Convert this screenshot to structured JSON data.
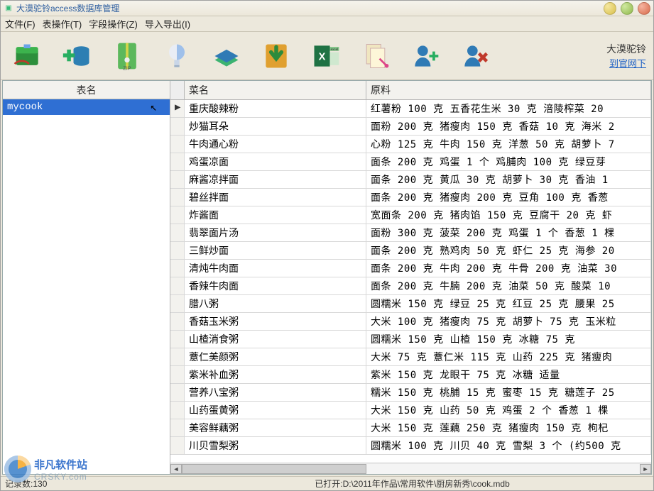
{
  "window": {
    "title": "大漠驼铃access数据库管理"
  },
  "menus": {
    "file": "文件(F)",
    "table_ops": "表操作(T)",
    "field_ops": "字段操作(Z)",
    "import_export": "导入导出(I)"
  },
  "toolbar": {
    "brand": "大漠驼铃",
    "link": "到官网下"
  },
  "left": {
    "header": "表名",
    "items": [
      "mycook"
    ],
    "selected_index": 0
  },
  "grid": {
    "columns": {
      "col1": "菜名",
      "col2": "原料"
    },
    "rows": [
      {
        "name": "重庆酸辣粉",
        "ingredients": "红薯粉 100 克 五香花生米 30 克 涪陵榨菜 20"
      },
      {
        "name": "炒猫耳朵",
        "ingredients": "面粉 200 克 猪瘦肉 150 克 香菇 10 克 海米 2"
      },
      {
        "name": "牛肉通心粉",
        "ingredients": "心粉 125 克 牛肉 150 克 洋葱 50 克 胡萝卜 7"
      },
      {
        "name": "鸡蛋凉面",
        "ingredients": "面条 200 克 鸡蛋 1 个 鸡脯肉 100 克 绿豆芽"
      },
      {
        "name": "麻酱凉拌面",
        "ingredients": "面条 200 克 黄瓜 30 克 胡萝卜 30 克  香油 1"
      },
      {
        "name": "碧丝拌面",
        "ingredients": "面条  200 克 猪瘦肉 200 克 豆角 100 克 香葱"
      },
      {
        "name": "炸酱面",
        "ingredients": "宽面条 200 克 猪肉馅 150 克 豆腐干 20 克 虾"
      },
      {
        "name": "翡翠面片汤",
        "ingredients": "面粉 300 克 菠菜 200 克 鸡蛋 1 个 香葱 1 棵"
      },
      {
        "name": "三鲜炒面",
        "ingredients": "面条 200 克 熟鸡肉 50 克 虾仁 25 克 海参 20"
      },
      {
        "name": "清炖牛肉面",
        "ingredients": "面条 200 克 牛肉  200 克 牛骨 200 克 油菜 30"
      },
      {
        "name": "香辣牛肉面",
        "ingredients": "面条 200 克 牛腩 200 克 油菜 50 克 酸菜 10"
      },
      {
        "name": "腊八粥",
        "ingredients": "圆糯米 150 克 绿豆 25 克 红豆 25 克 腰果 25"
      },
      {
        "name": "香菇玉米粥",
        "ingredients": "大米 100 克 猪瘦肉 75 克 胡萝卜 75 克 玉米粒"
      },
      {
        "name": "山楂消食粥",
        "ingredients": "圆糯米 150 克 山楂 150 克  冰糖 75 克"
      },
      {
        "name": "薏仁美颜粥",
        "ingredients": "大米 75 克 薏仁米 115 克 山药 225 克 猪瘦肉"
      },
      {
        "name": "紫米补血粥",
        "ingredients": "紫米 150 克 龙眼干 75 克  冰糖 适量"
      },
      {
        "name": "营养八宝粥",
        "ingredients": "糯米 150 克 桃脯 15 克 蜜枣 15 克 糖莲子 25"
      },
      {
        "name": "山药蛋黄粥",
        "ingredients": "大米 150 克 山药 50 克 鸡蛋 2 个 香葱 1 棵"
      },
      {
        "name": "美容鲜藕粥",
        "ingredients": "大米 150 克 莲藕 250 克 猪瘦肉 150 克 枸杞"
      },
      {
        "name": "川贝雪梨粥",
        "ingredients": "圆糯米 100 克 川贝 40 克 雪梨 3 个 (约500 克"
      }
    ],
    "current_row": 0
  },
  "status": {
    "record_count_label": "记录数:",
    "record_count": "130",
    "opened_label": "已打开:",
    "opened_path": "D:\\2011年作品\\常用软件\\厨房新秀\\cook.mdb"
  },
  "watermark": {
    "cn": "非凡软件站",
    "en": "CRSKY.com"
  }
}
